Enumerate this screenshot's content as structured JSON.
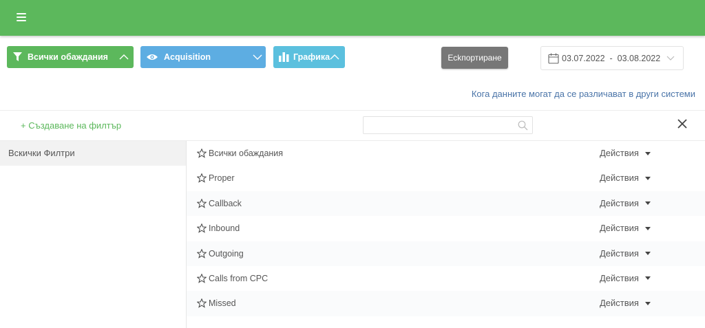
{
  "topbar": {
    "bg_color": "#5cb85c",
    "menu_icon": "hamburger-icon"
  },
  "toolbar": {
    "filter_button": {
      "label": "Всички обаждания",
      "icon": "filter-icon",
      "color": "#5cb85c"
    },
    "acquisition_button": {
      "label": "Acquisition",
      "icon": "eye-icon",
      "color": "#5dade2"
    },
    "chart_button": {
      "label": "Графика",
      "icon": "bar-chart-icon",
      "color": "#5bc0de"
    },
    "export_button": {
      "label": "Есkпортиране",
      "color": "#777777"
    },
    "date_range": {
      "start": "03.07.2022",
      "separator": "-",
      "end": "03.08.2022",
      "icon": "calendar-icon"
    }
  },
  "info_link": "Кога данните могат да се различават в други системи",
  "filter_panel": {
    "create_filter_label": "+ Създаване на филтър",
    "search": {
      "value": "",
      "placeholder": "",
      "icon": "search-icon"
    },
    "close_icon": "close-icon",
    "sidebar": {
      "items": [
        {
          "label": "Вскички Филтри"
        }
      ]
    },
    "actions_label": "Действия",
    "filters": [
      {
        "name": "Всички обаждания"
      },
      {
        "name": "Proper"
      },
      {
        "name": "Callback"
      },
      {
        "name": "Inbound"
      },
      {
        "name": "Outgoing"
      },
      {
        "name": "Calls from CPC"
      },
      {
        "name": "Missed"
      }
    ]
  }
}
